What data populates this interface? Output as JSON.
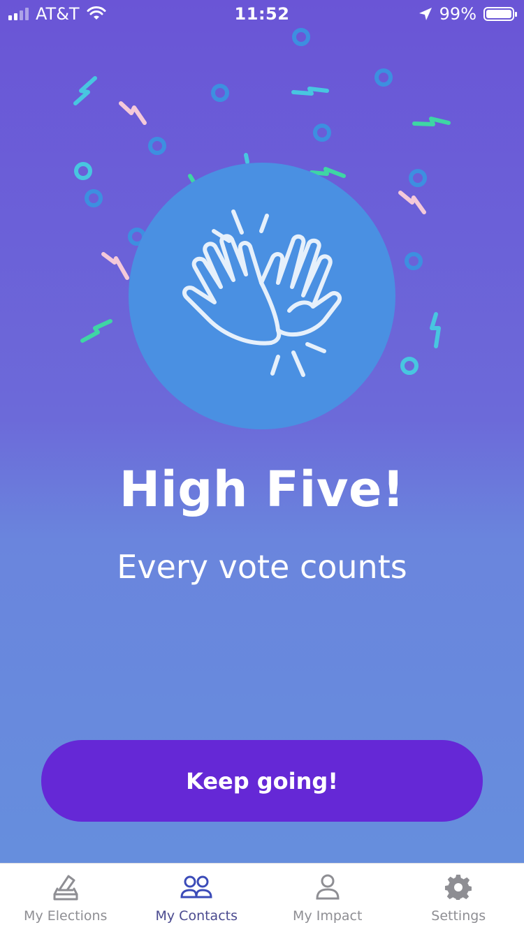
{
  "status_bar": {
    "carrier": "AT&T",
    "time": "11:52",
    "battery_percent": "99%",
    "battery_level": 0.99,
    "signal_icon": "signal-bars-icon",
    "wifi_icon": "wifi-icon",
    "location_icon": "location-arrow-icon"
  },
  "hero": {
    "icon": "high-five-hands-icon",
    "circle_color": "#4a90e2",
    "title": "High Five!",
    "subtitle": "Every vote counts"
  },
  "cta": {
    "label": "Keep going!",
    "color": "#6528d6"
  },
  "tabbar": {
    "active_color": "#3b4bb8",
    "inactive_color": "#8e8e93",
    "active_index": 1,
    "tabs": [
      {
        "label": "My Elections",
        "icon": "ballot-box-icon"
      },
      {
        "label": "My Contacts",
        "icon": "contacts-icon"
      },
      {
        "label": "My Impact",
        "icon": "person-icon"
      },
      {
        "label": "Settings",
        "icon": "gear-icon"
      }
    ]
  },
  "colors": {
    "background_top": "#6a55d6",
    "background_bottom": "#6590dd",
    "confetti_green": "#3ed6a4",
    "confetti_teal": "#48c6e0",
    "confetti_blue": "#3d8fe0",
    "confetti_pink": "#f4c9d9"
  }
}
